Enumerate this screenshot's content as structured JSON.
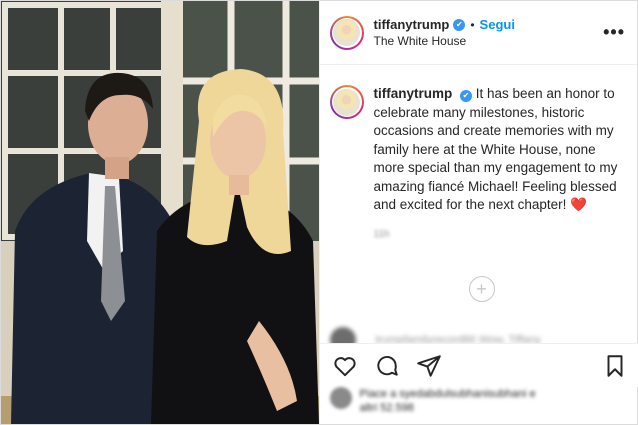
{
  "post": {
    "username": "tiffanytrump",
    "follow_label": "Segui",
    "separator": "•",
    "location": "The White House",
    "more_label": "•••",
    "caption": "It has been an honor to celebrate many milestones, historic occasions and create memories with my family here at the White House, none more special than my engagement to my amazing fiancé Michael! Feeling blessed and excited for the next chapter!",
    "caption_emoji": "❤️",
    "timestamp": "11h",
    "load_more_label": "+",
    "blurred_comment": "trumpfamilyrecord86 Wow, Tiffany",
    "likes_text_1": "Piace a syedabdulsubhanisubhani e",
    "likes_text_2": "altri 52.598"
  },
  "icons": {
    "verified": "verified-badge-icon",
    "like": "heart-outline-icon",
    "comment": "comment-bubble-icon",
    "share": "paper-plane-icon",
    "save": "bookmark-icon",
    "load_more": "plus-circle-icon",
    "menu": "more-options-icon"
  },
  "colors": {
    "link_blue": "#0095f6",
    "verified_blue": "#3897f0",
    "heart_red": "#e0245e",
    "border": "#dbdbdb"
  }
}
